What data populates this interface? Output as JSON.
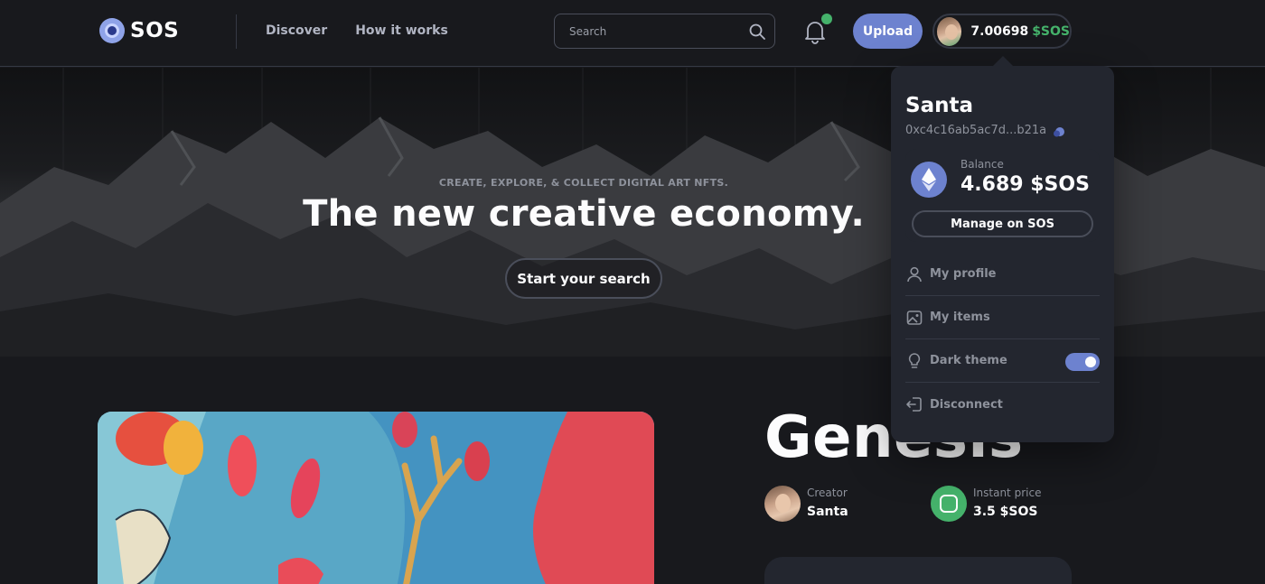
{
  "header": {
    "logo_text": "SOS",
    "nav": [
      "Discover",
      "How it works"
    ],
    "search_placeholder": "Search",
    "upload_label": "Upload",
    "wallet_balance": "7.00698",
    "wallet_currency": "$SOS",
    "notification_dot_color": "#45b26b"
  },
  "hero": {
    "kicker": "CREATE, EXPLORE, & COLLECT DIGITAL ART NFTS.",
    "title": "The new creative economy.",
    "button_label": "Start your search"
  },
  "item": {
    "title": "Genesis",
    "creator_label": "Creator",
    "creator_name": "Santa",
    "price_label": "Instant price",
    "price_value": "3.5 $SOS"
  },
  "dropdown": {
    "name": "Santa",
    "address": "0xc4c16ab5ac7d...b21a",
    "balance_label": "Balance",
    "balance_value": "4.689 $SOS",
    "manage_label": "Manage on SOS",
    "items": [
      {
        "label": "My profile",
        "icon": "user-icon"
      },
      {
        "label": "My items",
        "icon": "image-icon"
      },
      {
        "label": "Dark theme",
        "icon": "lightbulb-icon",
        "toggle": "on"
      },
      {
        "label": "Disconnect",
        "icon": "logout-icon"
      }
    ]
  },
  "colors": {
    "accent": "#6d82cf",
    "success": "#45b26b",
    "background": "#18191d",
    "surface": "#23262f"
  }
}
